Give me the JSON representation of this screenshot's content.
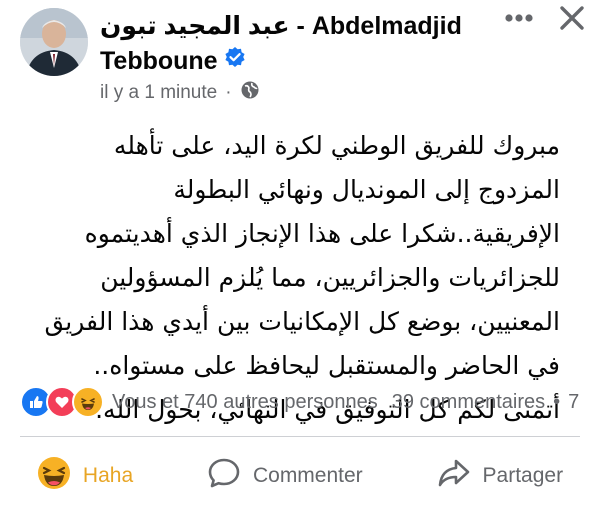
{
  "post": {
    "author": "عبد المجيد تبون - Abdelmadjid Tebboune",
    "timestamp": "il y a 1 minute",
    "audience_icon": "globe-icon",
    "text": "مبروك للفريق الوطني لكرة اليد، على تأهله المزدوج إلى المونديال ونهائي البطولة الإفريقية..شكرا على هذا الإنجاز الذي أهديتموه للجزائريات والجزائريين، مما يُلزم المسؤولين المعنيين، بوضع كل الإمكانيات بين أيدي هذا الفريق في الحاضر والمستقبل ليحافظ على مستواه.. أتمنى لكم كل التوفيق في النهائي، بحول الله."
  },
  "reactions": {
    "summary": "Vous et 740 autres personnes",
    "comments": "39 commentaires",
    "separator": "•",
    "overflow": "7",
    "icons": [
      "like-icon",
      "love-icon",
      "haha-icon"
    ]
  },
  "actions": {
    "reaction_label": "Haha",
    "comment_label": "Commenter",
    "share_label": "Partager"
  },
  "colors": {
    "like": "#1877f2",
    "love": "#f33e58",
    "haha": "#f7b125",
    "verified": "#1877f2",
    "muted": "#65676b"
  }
}
